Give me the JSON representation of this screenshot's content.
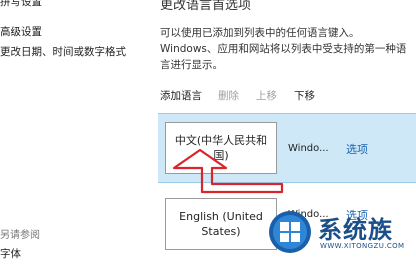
{
  "sidebar": {
    "links": [
      "高级设置",
      "更改日期、时间或数字格式"
    ],
    "see_also_title": "另请参阅",
    "see_also_links": [
      "字体"
    ]
  },
  "page": {
    "title": "更改语言首选项",
    "description": "可以使用已添加到列表中的任何语言键入。 Windows、应用和网站将以列表中受支持的第一种语言进行显示。"
  },
  "toolbar": {
    "add": "添加语言",
    "remove": "删除",
    "move_up": "上移",
    "move_down": "下移"
  },
  "languages": [
    {
      "name": "中文(中华人民共和国)",
      "windows_status": "Windo...",
      "options_label": "选项"
    },
    {
      "name": "English (United States)",
      "windows_status": "Windo...",
      "options_label": "选项"
    }
  ],
  "annotation": {
    "color": "#d9262c"
  },
  "watermark": {
    "brand": "系统族",
    "url": "WWW.XITONGZU.COM"
  }
}
